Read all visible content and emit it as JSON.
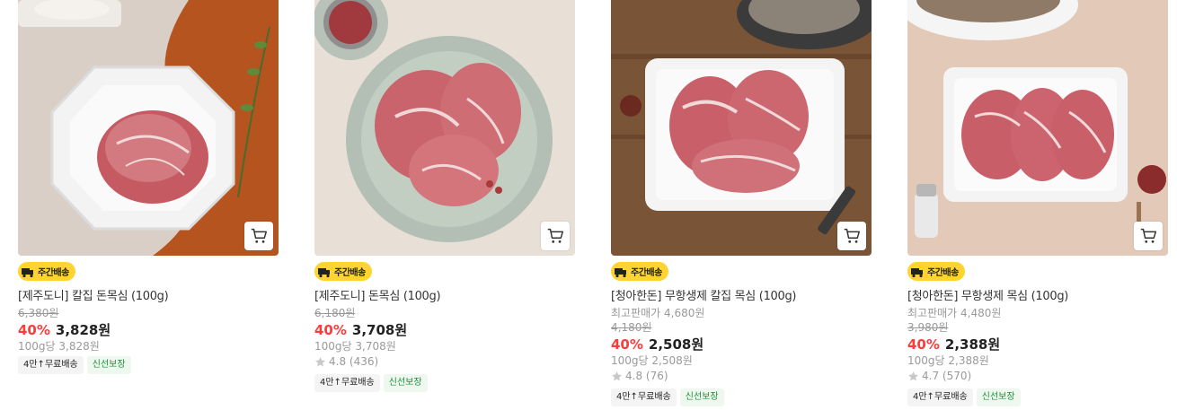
{
  "products": [
    {
      "badge": "주간배송",
      "name": "[제주도니] 칼집 돈목심 (100g)",
      "original_price": "6,380원",
      "discount": "40%",
      "price": "3,828원",
      "unit_price": "100g당 3,828원",
      "tags": [
        "4만↑무료배송",
        "신선보장"
      ]
    },
    {
      "badge": "주간배송",
      "name": "[제주도니] 돈목심 (100g)",
      "original_price": "6,180원",
      "discount": "40%",
      "price": "3,708원",
      "unit_price": "100g당 3,708원",
      "rating": "4.8 (436)",
      "tags": [
        "4만↑무료배송",
        "신선보장"
      ]
    },
    {
      "badge": "주간배송",
      "name": "[청아한돈] 무항생제 칼집 목심 (100g)",
      "best_price": "최고판매가 4,680원",
      "original_price": "4,180원",
      "discount": "40%",
      "price": "2,508원",
      "unit_price": "100g당 2,508원",
      "rating": "4.8 (76)",
      "tags": [
        "4만↑무료배송",
        "신선보장"
      ]
    },
    {
      "badge": "주간배송",
      "name": "[청아한돈] 무항생제 목심 (100g)",
      "best_price": "최고판매가 4,480원",
      "original_price": "3,980원",
      "discount": "40%",
      "price": "2,388원",
      "unit_price": "100g당 2,388원",
      "rating": "4.7 (570)",
      "tags": [
        "4만↑무료배송",
        "신선보장"
      ]
    }
  ],
  "colors": {
    "discount": "#fa3c3c",
    "badge": "#fed332",
    "fresh_tag": "#1f8f3a"
  },
  "icons": [
    "cart-icon",
    "truck-icon",
    "star-icon"
  ]
}
